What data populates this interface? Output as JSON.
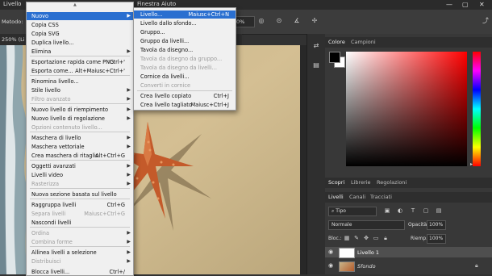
{
  "menubar": {
    "left_label": "Livello",
    "right_items": [
      "Finestra",
      "Aiuto"
    ]
  },
  "optbar": {
    "method_label": "Metodo:",
    "opacity_value": "0%"
  },
  "doc_tab": "250% (Li",
  "main_menu": {
    "items": [
      {
        "label": "Nuovo",
        "submenu": true,
        "highlighted": true
      },
      {
        "label": "Copia CSS"
      },
      {
        "label": "Copia SVG"
      },
      {
        "label": "Duplica livello..."
      },
      {
        "label": "Elimina",
        "submenu": true
      },
      {
        "label": "Esportazione rapida come PNG",
        "shortcut": "Ctrl+'"
      },
      {
        "label": "Esporta come...",
        "shortcut": "Alt+Maiusc+Ctrl+'"
      },
      {
        "label": "Rinomina livello..."
      },
      {
        "label": "Stile livello",
        "submenu": true
      },
      {
        "label": "Filtro avanzato",
        "disabled": true,
        "submenu": true
      },
      {
        "label": "Nuovo livello di riempimento",
        "submenu": true
      },
      {
        "label": "Nuovo livello di regolazione",
        "submenu": true
      },
      {
        "label": "Opzioni contenuto livello...",
        "disabled": true
      },
      {
        "label": "Maschera di livello",
        "submenu": true
      },
      {
        "label": "Maschera vettoriale",
        "submenu": true
      },
      {
        "label": "Crea maschera di ritaglio",
        "shortcut": "Alt+Ctrl+G"
      },
      {
        "label": "Oggetti avanzati",
        "submenu": true
      },
      {
        "label": "Livelli video",
        "submenu": true
      },
      {
        "label": "Rasterizza",
        "disabled": true,
        "submenu": true
      },
      {
        "label": "Nuova sezione basata sul livello"
      },
      {
        "label": "Raggruppa livelli",
        "shortcut": "Ctrl+G"
      },
      {
        "label": "Separa livelli",
        "shortcut": "Maiusc+Ctrl+G",
        "disabled": true
      },
      {
        "label": "Nascondi livelli"
      },
      {
        "label": "Ordina",
        "disabled": true,
        "submenu": true
      },
      {
        "label": "Combina forme",
        "disabled": true,
        "submenu": true
      },
      {
        "label": "Allinea livelli a selezione",
        "submenu": true
      },
      {
        "label": "Distribuisci",
        "disabled": true,
        "submenu": true
      },
      {
        "label": "Blocca livelli...",
        "shortcut": "Ctrl+/"
      }
    ]
  },
  "sub_menu": {
    "items": [
      {
        "label": "Livello...",
        "shortcut": "Maiusc+Ctrl+N",
        "highlighted": true
      },
      {
        "label": "Livello dallo sfondo..."
      },
      {
        "label": "Gruppo..."
      },
      {
        "label": "Gruppo da livelli..."
      },
      {
        "label": "Tavola da disegno..."
      },
      {
        "label": "Tavola da disegno da gruppo...",
        "disabled": true
      },
      {
        "label": "Tavola da disegno da livelli...",
        "disabled": true
      },
      {
        "label": "Cornice da livelli..."
      },
      {
        "label": "Converti in cornice",
        "disabled": true
      },
      {
        "label": "Crea livello copiato",
        "shortcut": "Ctrl+J"
      },
      {
        "label": "Crea livello tagliato",
        "shortcut": "Maiusc+Ctrl+J"
      }
    ]
  },
  "color_panel": {
    "tabs": [
      "Colore",
      "Campioni"
    ],
    "foreground": "#000000",
    "background": "#ffffff",
    "hue_color": "#ff0000"
  },
  "layer_panel": {
    "top_tabs": [
      "Scopri",
      "Librerie",
      "Regolazioni"
    ],
    "tabs": [
      "Livelli",
      "Canali",
      "Tracciati"
    ],
    "filter_label": "Tipo",
    "blend_mode": "Normale",
    "opacity_label": "Opacità:",
    "opacity_value": "100%",
    "lock_label": "Bloc.:",
    "fill_label": "Riemp.:",
    "fill_value": "100%",
    "layers": [
      {
        "name": "Livello 1",
        "selected": true
      },
      {
        "name": "Sfondo",
        "locked": true
      }
    ]
  }
}
